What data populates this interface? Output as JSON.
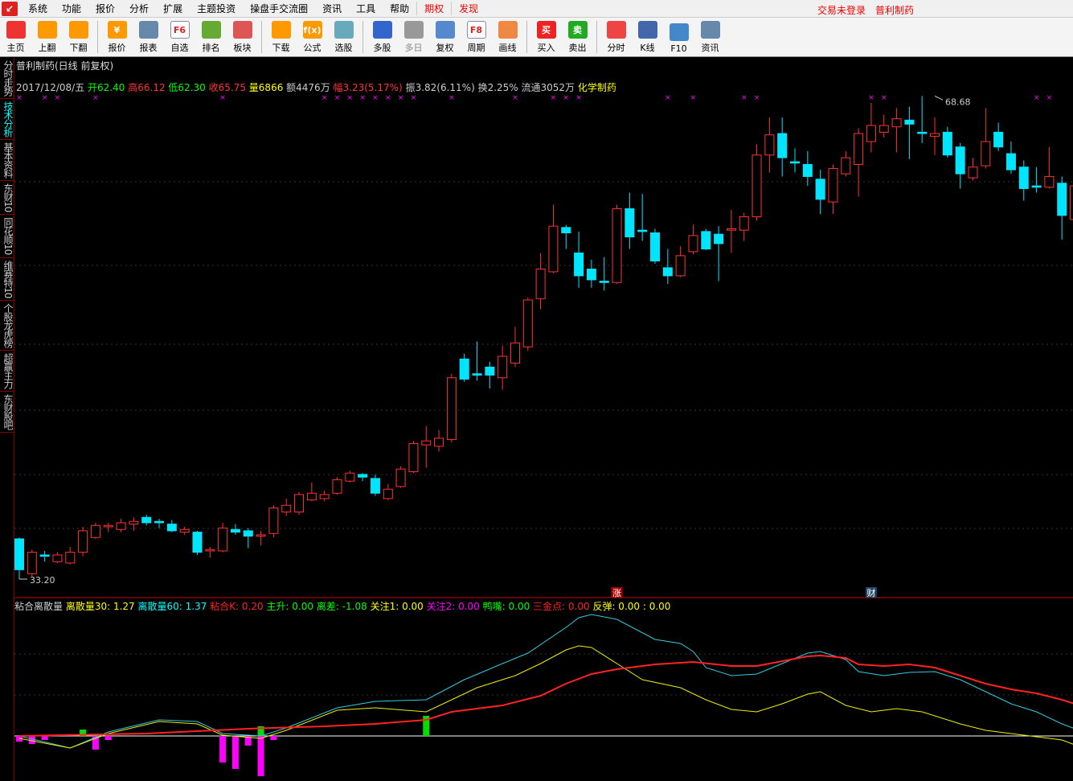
{
  "menu": {
    "items": [
      "系统",
      "功能",
      "报价",
      "分析",
      "扩展",
      "主题投资",
      "操盘手交流圈",
      "资讯",
      "工具",
      "帮助"
    ],
    "special": [
      "期权",
      "发现"
    ],
    "account": "交易未登录",
    "stock_name_right": "普利制药"
  },
  "toolbar": [
    {
      "label": "主页",
      "icon": "home-icon",
      "color": "#e33"
    },
    {
      "label": "上翻",
      "icon": "arrow-up-icon",
      "color": "#f90"
    },
    {
      "label": "下翻",
      "icon": "arrow-down-icon",
      "color": "#f90"
    },
    {
      "sep": true
    },
    {
      "label": "报价",
      "icon": "yen-icon",
      "color": "#f90",
      "glyph": "¥"
    },
    {
      "label": "报表",
      "icon": "table-icon",
      "color": "#68a"
    },
    {
      "label": "自选",
      "icon": "f6-icon",
      "color": "#fff",
      "glyph": "F6"
    },
    {
      "label": "排名",
      "icon": "rank-icon",
      "color": "#6a3"
    },
    {
      "label": "板块",
      "icon": "blocks-icon",
      "color": "#d55"
    },
    {
      "sep": true
    },
    {
      "label": "下载",
      "icon": "download-icon",
      "color": "#f90"
    },
    {
      "label": "公式",
      "icon": "formula-icon",
      "color": "#f90",
      "glyph": "f(x)"
    },
    {
      "label": "选股",
      "icon": "pick-icon",
      "color": "#6ab"
    },
    {
      "sep": true
    },
    {
      "label": "多股",
      "icon": "multi-icon",
      "color": "#36c"
    },
    {
      "label": "多日",
      "icon": "clock-icon",
      "color": "#999",
      "disabled": true
    },
    {
      "label": "复权",
      "icon": "restore-icon",
      "color": "#58c"
    },
    {
      "label": "周期",
      "icon": "f8-icon",
      "color": "#fff",
      "glyph": "F8"
    },
    {
      "label": "画线",
      "icon": "pencil-icon",
      "color": "#e84"
    },
    {
      "sep": true
    },
    {
      "label": "买入",
      "icon": "buy-icon",
      "color": "#e22",
      "glyph": "买"
    },
    {
      "label": "卖出",
      "icon": "sell-icon",
      "color": "#2a2",
      "glyph": "卖"
    },
    {
      "sep": true
    },
    {
      "label": "分时",
      "icon": "intraday-icon",
      "color": "#e44"
    },
    {
      "label": "K线",
      "icon": "kline-icon",
      "color": "#46a"
    },
    {
      "label": "F10",
      "icon": "f10-icon",
      "color": "#48c"
    },
    {
      "label": "资讯",
      "icon": "news-icon",
      "color": "#68a"
    }
  ],
  "left_tabs": [
    "分时走势",
    "技术分析",
    "基本资料",
    "东财10",
    "同花顺10",
    "维赛特10",
    "个股龙虎榜",
    "超赢主力",
    "东财股吧"
  ],
  "active_tab": 1,
  "header": {
    "title": "普利制药(日线 前复权)",
    "info": [
      {
        "t": "2017/12/08/五 ",
        "c": "#ccc"
      },
      {
        "t": "开",
        "c": "#0f0"
      },
      {
        "t": "62.40 ",
        "c": "#0f0"
      },
      {
        "t": "高",
        "c": "#f33"
      },
      {
        "t": "66.12 ",
        "c": "#f33"
      },
      {
        "t": "低",
        "c": "#0f0"
      },
      {
        "t": "62.30 ",
        "c": "#0f0"
      },
      {
        "t": "收",
        "c": "#f33"
      },
      {
        "t": "65.75 ",
        "c": "#f33"
      },
      {
        "t": "量",
        "c": "#ff0"
      },
      {
        "t": "6866 ",
        "c": "#ff0"
      },
      {
        "t": "额4476万 ",
        "c": "#ccc"
      },
      {
        "t": "幅",
        "c": "#f33"
      },
      {
        "t": "3.23(5.17%) ",
        "c": "#f33"
      },
      {
        "t": "振3.82(6.11%) 换2.25% 流通3052万 ",
        "c": "#ccc"
      },
      {
        "t": "化学制药",
        "c": "#ff0"
      }
    ]
  },
  "indicator": {
    "items": [
      {
        "t": "粘合离散量  ",
        "c": "#ccc"
      },
      {
        "t": "离散量30: 1.27  ",
        "c": "#ff0"
      },
      {
        "t": "离散量60: 1.37  ",
        "c": "#0ff"
      },
      {
        "t": "粘合K: 0.20  ",
        "c": "#f22"
      },
      {
        "t": "主升: 0.00  ",
        "c": "#0f0"
      },
      {
        "t": "离差: -1.08  ",
        "c": "#0f0"
      },
      {
        "t": "关注1: 0.00  ",
        "c": "#ff0"
      },
      {
        "t": "关注2: 0.00  ",
        "c": "#f0f"
      },
      {
        "t": "鸭嘴: 0.00  ",
        "c": "#0f0"
      },
      {
        "t": "三金点: 0.00  ",
        "c": "#f22"
      },
      {
        "t": "反弹: 0.00  : 0.00",
        "c": "#ff0"
      }
    ]
  },
  "labels": {
    "high": "68.68",
    "low": "33.20",
    "event1": "涨",
    "event2": "财",
    "marker": "×"
  },
  "colors": {
    "up": "#ff3232",
    "down": "#00e5ff",
    "ma_cyan": "#3cd",
    "ma_yellow": "#ee0",
    "ma_red": "#f22"
  },
  "chart_data": {
    "type": "candlestick",
    "price_range": [
      33.2,
      68.68
    ],
    "ohlc": [
      [
        36.2,
        33.9,
        36.3,
        33.2
      ],
      [
        33.6,
        35.2,
        35.4,
        33.4
      ],
      [
        35.0,
        34.9,
        35.3,
        34.5
      ],
      [
        34.5,
        35.0,
        35.2,
        34.4
      ],
      [
        34.4,
        35.2,
        35.6,
        34.3
      ],
      [
        35.2,
        36.8,
        37.1,
        34.9
      ],
      [
        36.3,
        37.2,
        37.4,
        36.2
      ],
      [
        37.1,
        37.2,
        37.4,
        36.7
      ],
      [
        36.9,
        37.4,
        37.7,
        36.7
      ],
      [
        37.3,
        37.5,
        37.8,
        36.8
      ],
      [
        37.8,
        37.4,
        38.0,
        37.2
      ],
      [
        37.5,
        37.4,
        37.7,
        37.0
      ],
      [
        37.3,
        36.8,
        37.6,
        36.7
      ],
      [
        36.7,
        36.9,
        37.1,
        36.5
      ],
      [
        36.7,
        35.2,
        36.8,
        35.0
      ],
      [
        35.3,
        35.4,
        35.6,
        34.8
      ],
      [
        35.3,
        37.0,
        37.4,
        35.2
      ],
      [
        36.9,
        36.7,
        37.3,
        36.5
      ],
      [
        36.8,
        36.4,
        37.0,
        35.5
      ],
      [
        36.4,
        36.5,
        36.8,
        35.7
      ],
      [
        36.6,
        38.5,
        38.7,
        36.3
      ],
      [
        38.2,
        38.7,
        39.2,
        37.9
      ],
      [
        38.2,
        39.5,
        39.7,
        38.0
      ],
      [
        39.1,
        39.6,
        40.4,
        39.0
      ],
      [
        39.2,
        39.5,
        39.8,
        39.0
      ],
      [
        39.6,
        40.6,
        40.8,
        39.5
      ],
      [
        40.5,
        41.1,
        41.3,
        40.4
      ],
      [
        41.0,
        40.8,
        41.1,
        40.5
      ],
      [
        40.7,
        39.6,
        41.0,
        39.4
      ],
      [
        39.2,
        39.9,
        40.3,
        39.1
      ],
      [
        40.1,
        41.4,
        41.6,
        40.0
      ],
      [
        41.2,
        43.3,
        43.5,
        41.1
      ],
      [
        43.2,
        43.5,
        44.6,
        41.5
      ],
      [
        43.1,
        43.7,
        44.3,
        42.7
      ],
      [
        43.6,
        48.2,
        48.5,
        43.4
      ],
      [
        49.6,
        48.1,
        50.0,
        47.9
      ],
      [
        48.5,
        48.4,
        50.9,
        48.0
      ],
      [
        49.0,
        48.4,
        49.4,
        47.4
      ],
      [
        48.2,
        49.8,
        50.6,
        47.3
      ],
      [
        49.3,
        50.8,
        52.0,
        49.0
      ],
      [
        50.5,
        54.0,
        54.2,
        50.2
      ],
      [
        54.1,
        56.3,
        57.5,
        53.3
      ],
      [
        56.1,
        59.5,
        61.1,
        56.0
      ],
      [
        59.4,
        59.0,
        59.6,
        57.8
      ],
      [
        57.5,
        55.8,
        59.1,
        54.9
      ],
      [
        56.3,
        55.5,
        57.0,
        54.9
      ],
      [
        55.4,
        55.3,
        57.2,
        54.7
      ],
      [
        55.3,
        60.8,
        61.1,
        55.2
      ],
      [
        60.8,
        58.7,
        62.0,
        57.8
      ],
      [
        59.2,
        59.1,
        61.9,
        58.4
      ],
      [
        59.0,
        56.9,
        59.3,
        56.7
      ],
      [
        56.4,
        55.8,
        57.8,
        55.2
      ],
      [
        55.8,
        57.3,
        58.0,
        55.7
      ],
      [
        57.6,
        58.8,
        59.6,
        57.4
      ],
      [
        59.1,
        57.8,
        59.3,
        57.7
      ],
      [
        58.9,
        58.2,
        59.5,
        55.4
      ],
      [
        59.2,
        59.3,
        60.7,
        57.5
      ],
      [
        59.2,
        60.2,
        60.5,
        58.4
      ],
      [
        60.2,
        64.8,
        65.6,
        59.9
      ],
      [
        64.8,
        66.3,
        67.6,
        63.5
      ],
      [
        66.4,
        64.6,
        67.6,
        63.2
      ],
      [
        64.3,
        64.2,
        65.3,
        63.5
      ],
      [
        64.1,
        63.2,
        65.1,
        62.5
      ],
      [
        63.0,
        61.5,
        63.7,
        60.4
      ],
      [
        61.3,
        63.8,
        64.1,
        60.4
      ],
      [
        63.4,
        64.6,
        65.1,
        63.2
      ],
      [
        64.1,
        66.4,
        66.8,
        61.7
      ],
      [
        65.8,
        67.0,
        68.68,
        65.0
      ],
      [
        66.5,
        67.0,
        67.8,
        66.1
      ],
      [
        66.9,
        67.5,
        68.3,
        65.0
      ],
      [
        67.4,
        67.1,
        68.4,
        64.5
      ],
      [
        66.5,
        66.4,
        69.2,
        65.7
      ],
      [
        66.2,
        66.4,
        67.6,
        64.8
      ],
      [
        66.5,
        64.8,
        66.9,
        64.6
      ],
      [
        65.4,
        63.4,
        65.7,
        62.3
      ],
      [
        63.1,
        63.9,
        64.6,
        62.9
      ],
      [
        64.0,
        65.8,
        68.3,
        63.8
      ],
      [
        66.5,
        65.4,
        67.2,
        65.1
      ],
      [
        64.9,
        63.7,
        65.8,
        63.4
      ],
      [
        63.9,
        62.3,
        64.4,
        61.4
      ],
      [
        62.5,
        62.4,
        63.9,
        62.0
      ],
      [
        62.4,
        63.2,
        65.4,
        62.3
      ],
      [
        62.7,
        60.3,
        63.2,
        58.5
      ],
      [
        60.0,
        62.5,
        63.0,
        59.5
      ]
    ],
    "marker_indices": [
      0,
      2,
      3,
      6,
      16,
      24,
      25,
      26,
      27,
      28,
      29,
      30,
      31,
      34,
      39,
      42,
      43,
      44,
      51,
      53,
      57,
      58,
      67,
      68,
      80,
      81
    ],
    "event_indices": [
      47,
      67
    ],
    "indicator_series": [
      {
        "name": "离散量60",
        "color": "#3cd",
        "points": [
          [
            0,
            0
          ],
          [
            4,
            -0.15
          ],
          [
            7,
            0.05
          ],
          [
            11,
            0.2
          ],
          [
            14,
            0.18
          ],
          [
            16,
            0.03
          ],
          [
            19,
            0
          ],
          [
            21,
            0.1
          ],
          [
            25,
            0.35
          ],
          [
            28,
            0.43
          ],
          [
            32,
            0.45
          ],
          [
            35,
            0.7
          ],
          [
            38,
            0.9
          ],
          [
            40,
            1.03
          ],
          [
            43,
            1.35
          ],
          [
            44,
            1.47
          ],
          [
            45,
            1.51
          ],
          [
            47,
            1.45
          ],
          [
            50,
            1.2
          ],
          [
            52,
            1.15
          ],
          [
            53,
            1.05
          ],
          [
            54,
            0.85
          ],
          [
            56,
            0.75
          ],
          [
            58,
            0.77
          ],
          [
            60,
            0.9
          ],
          [
            62,
            1.03
          ],
          [
            63,
            1.05
          ],
          [
            65,
            0.95
          ],
          [
            66,
            0.8
          ],
          [
            68,
            0.75
          ],
          [
            70,
            0.79
          ],
          [
            72,
            0.8
          ],
          [
            74,
            0.7
          ],
          [
            76,
            0.55
          ],
          [
            78,
            0.4
          ],
          [
            80,
            0.3
          ],
          [
            82,
            0.15
          ],
          [
            84,
            0.03
          ]
        ]
      },
      {
        "name": "离散量30",
        "color": "#ee0",
        "points": [
          [
            0,
            -0.03
          ],
          [
            4,
            -0.15
          ],
          [
            7,
            0.03
          ],
          [
            11,
            0.18
          ],
          [
            14,
            0.15
          ],
          [
            16,
            0.01
          ],
          [
            19,
            -0.03
          ],
          [
            21,
            0.07
          ],
          [
            25,
            0.32
          ],
          [
            28,
            0.35
          ],
          [
            32,
            0.3
          ],
          [
            34,
            0.45
          ],
          [
            36,
            0.6
          ],
          [
            39,
            0.75
          ],
          [
            41,
            0.9
          ],
          [
            43,
            1.07
          ],
          [
            44,
            1.12
          ],
          [
            45,
            1.1
          ],
          [
            47,
            0.9
          ],
          [
            49,
            0.7
          ],
          [
            52,
            0.6
          ],
          [
            54,
            0.45
          ],
          [
            56,
            0.33
          ],
          [
            58,
            0.3
          ],
          [
            60,
            0.4
          ],
          [
            62,
            0.52
          ],
          [
            63,
            0.55
          ],
          [
            65,
            0.38
          ],
          [
            67,
            0.3
          ],
          [
            69,
            0.34
          ],
          [
            71,
            0.3
          ],
          [
            74,
            0.15
          ],
          [
            76,
            0.07
          ],
          [
            78,
            0.03
          ],
          [
            80,
            -0.01
          ],
          [
            82,
            -0.05
          ],
          [
            84,
            -0.17
          ]
        ]
      },
      {
        "name": "粘合K",
        "color": "#f22",
        "points": [
          [
            0,
            0
          ],
          [
            10,
            0.03
          ],
          [
            18,
            0.09
          ],
          [
            24,
            0.12
          ],
          [
            28,
            0.15
          ],
          [
            32,
            0.2
          ],
          [
            34,
            0.3
          ],
          [
            38,
            0.38
          ],
          [
            41,
            0.5
          ],
          [
            43,
            0.65
          ],
          [
            45,
            0.77
          ],
          [
            47,
            0.83
          ],
          [
            50,
            0.89
          ],
          [
            53,
            0.92
          ],
          [
            56,
            0.87
          ],
          [
            58,
            0.87
          ],
          [
            60,
            0.93
          ],
          [
            62,
            0.99
          ],
          [
            63,
            1.0
          ],
          [
            65,
            0.97
          ],
          [
            66,
            0.89
          ],
          [
            68,
            0.87
          ],
          [
            70,
            0.89
          ],
          [
            72,
            0.85
          ],
          [
            74,
            0.75
          ],
          [
            76,
            0.65
          ],
          [
            78,
            0.58
          ],
          [
            80,
            0.53
          ],
          [
            82,
            0.45
          ],
          [
            84,
            0.35
          ]
        ]
      }
    ],
    "histogram": [
      {
        "i": 0,
        "v": -0.07,
        "c": "#f0f"
      },
      {
        "i": 1,
        "v": -0.1,
        "c": "#f0f"
      },
      {
        "i": 2,
        "v": -0.05,
        "c": "#f0f"
      },
      {
        "i": 5,
        "v": 0.08,
        "c": "#0d0"
      },
      {
        "i": 6,
        "v": -0.17,
        "c": "#f0f"
      },
      {
        "i": 7,
        "v": -0.05,
        "c": "#f0f"
      },
      {
        "i": 16,
        "v": -0.33,
        "c": "#f0f"
      },
      {
        "i": 17,
        "v": -0.41,
        "c": "#f0f"
      },
      {
        "i": 18,
        "v": -0.12,
        "c": "#f0f"
      },
      {
        "i": 19,
        "v": -0.5,
        "c": "#f0f"
      },
      {
        "i": 19,
        "v": 0.12,
        "c": "#0d0"
      },
      {
        "i": 20,
        "v": -0.05,
        "c": "#f0f"
      },
      {
        "i": 32,
        "v": 0.25,
        "c": "#0d0"
      }
    ]
  }
}
